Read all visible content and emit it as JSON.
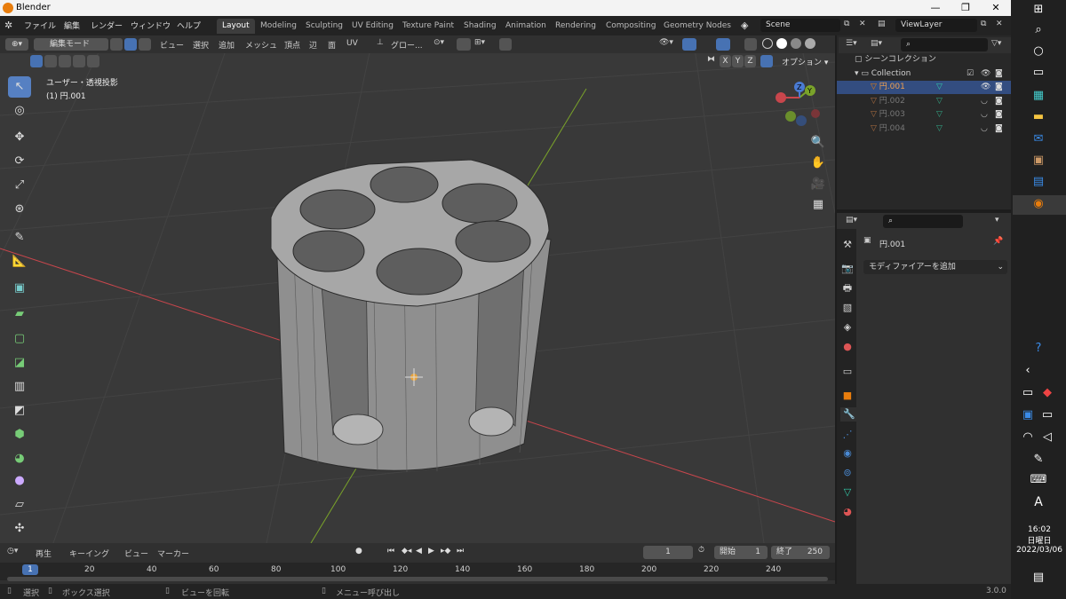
{
  "app": {
    "title": "Blender",
    "version": "3.0.0"
  },
  "menus": [
    "ファイル",
    "編集",
    "レンダー",
    "ウィンドウ",
    "ヘルプ"
  ],
  "workspaces": [
    "Layout",
    "Modeling",
    "Sculpting",
    "UV Editing",
    "Texture Paint",
    "Shading",
    "Animation",
    "Rendering",
    "Compositing",
    "Geometry Nodes"
  ],
  "scene": "Scene",
  "view_layer": "ViewLayer",
  "viewport_header": {
    "mode": "編集モード",
    "menus": [
      "ビュー",
      "選択",
      "追加",
      "メッシュ",
      "頂点",
      "辺",
      "面",
      "UV"
    ],
    "orientation": "グロー...",
    "axes": [
      "X",
      "Y",
      "Z"
    ],
    "options": "オプション"
  },
  "viewport_info": {
    "view": "ユーザー・透視投影",
    "object": "(1) 円.001"
  },
  "gizmo": {
    "z": "Z",
    "y": "Y"
  },
  "outliner": {
    "scene_collection": "シーンコレクション",
    "collection": "Collection",
    "objects": [
      "円.001",
      "円.002",
      "円.003",
      "円.004"
    ]
  },
  "properties": {
    "object_name": "円.001",
    "add_modifier": "モディファイアーを追加"
  },
  "timeline": {
    "menus": [
      "再生",
      "キーイング",
      "ビュー",
      "マーカー"
    ],
    "current_frame": "1",
    "start_label": "開始",
    "start": "1",
    "end_label": "終了",
    "end": "250",
    "ticks": [
      "1",
      "20",
      "40",
      "60",
      "80",
      "100",
      "120",
      "140",
      "160",
      "180",
      "200",
      "220",
      "240"
    ]
  },
  "statusbar": {
    "select": "選択",
    "box_select": "ボックス選択",
    "rotate": "ビューを回転",
    "menu": "メニュー呼び出し"
  },
  "taskbar": {
    "time": "16:02",
    "day": "日曜日",
    "date": "2022/03/06",
    "ime": "A"
  },
  "colors": {
    "accent": "#4772b3",
    "active_object": "#e87d0d",
    "background": "#393939",
    "x_axis": "#c8464c",
    "y_axis": "#7aa32a"
  }
}
